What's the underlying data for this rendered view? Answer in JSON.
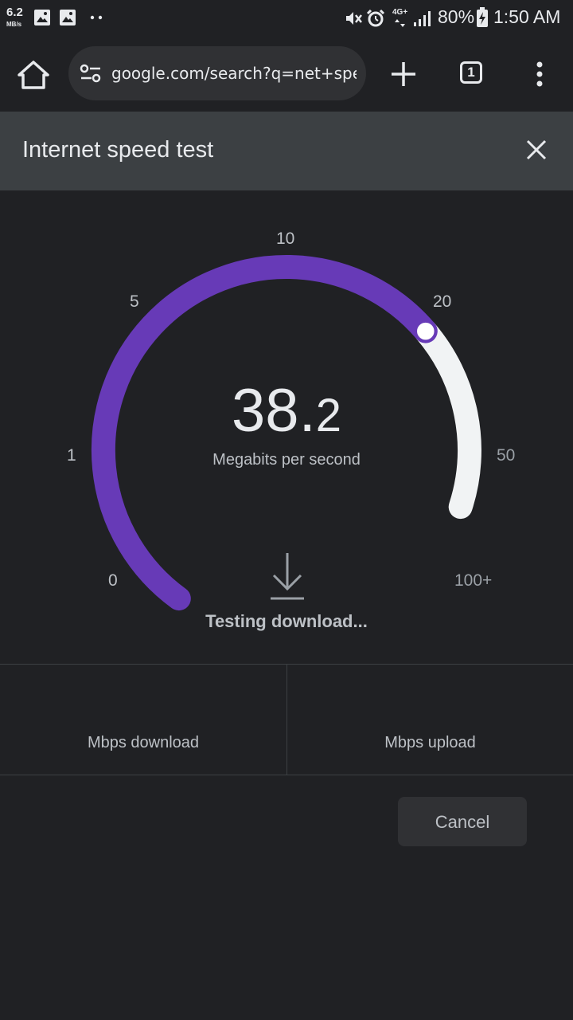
{
  "status_bar": {
    "net_speed": "6.2",
    "net_speed_unit": "MB/s",
    "network": "4G+",
    "battery": "80%",
    "time": "1:50 AM"
  },
  "toolbar": {
    "url": "google.com/search?q=net+speed",
    "tab_count": "1"
  },
  "header": {
    "title": "Internet speed test"
  },
  "gauge": {
    "value_int": "38.",
    "value_dec": "2",
    "unit": "Megabits per second",
    "scale_labels": [
      "0",
      "1",
      "5",
      "10",
      "20",
      "50",
      "100+"
    ],
    "progress_value": 38.2,
    "accent_color": "#673ab7",
    "track_color": "#f1f3f4"
  },
  "status": {
    "text": "Testing download..."
  },
  "results": {
    "download_label": "Mbps download",
    "upload_label": "Mbps upload"
  },
  "actions": {
    "cancel_label": "Cancel"
  }
}
